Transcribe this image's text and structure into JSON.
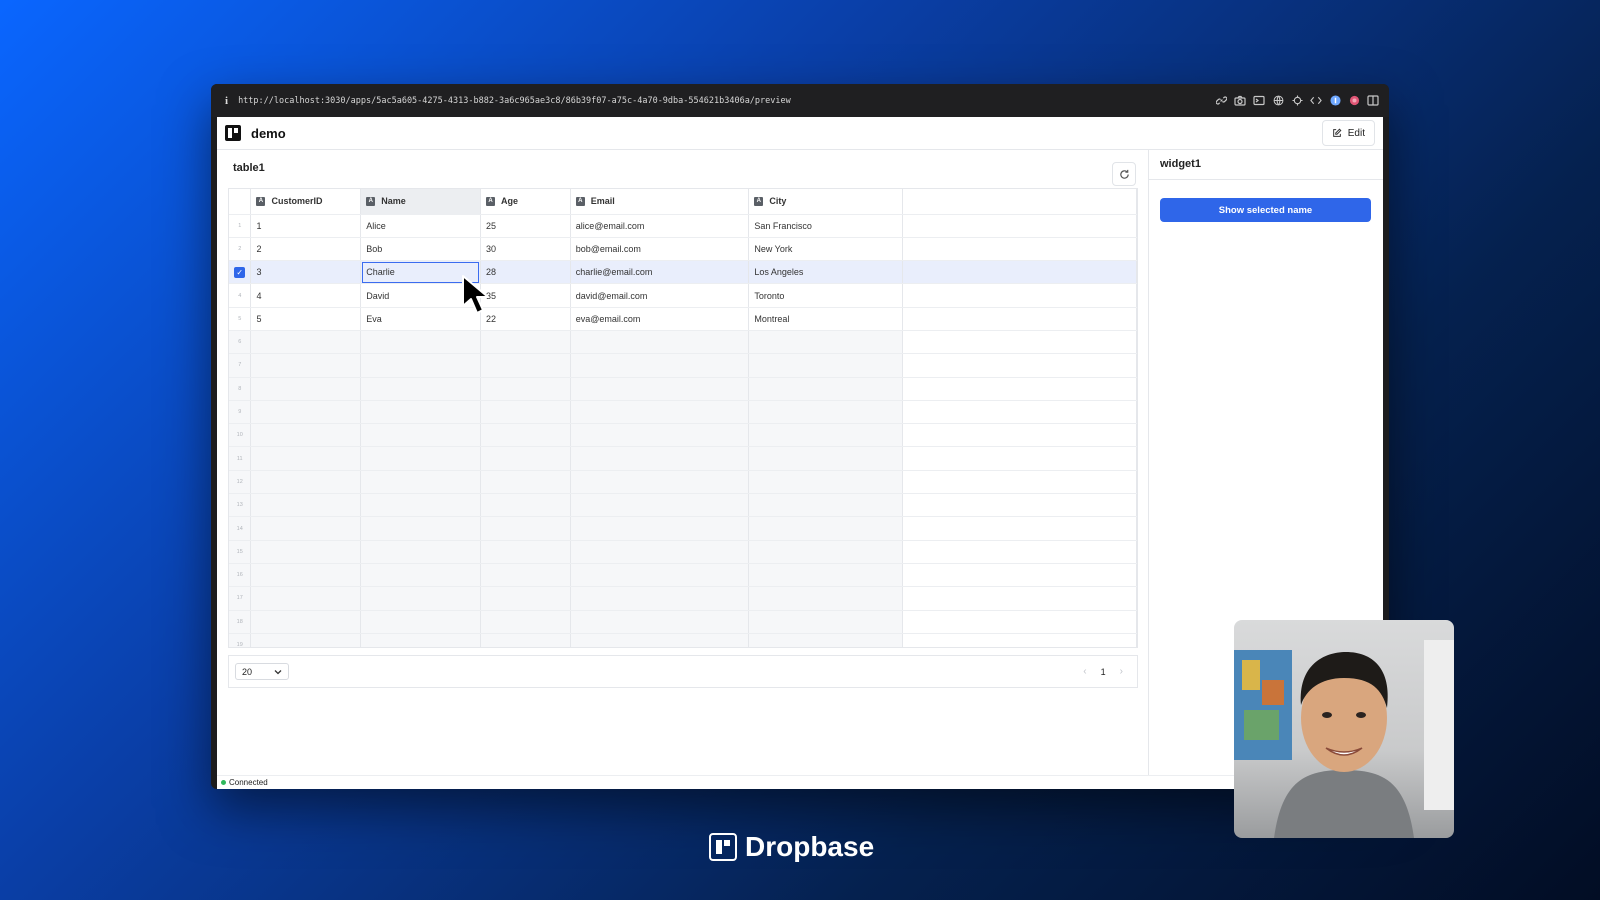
{
  "browser": {
    "url": "http://localhost:3030/apps/5ac5a605-4275-4313-b882-3a6c965ae3c8/86b39f07-a75c-4a70-9dba-554621b3406a/preview",
    "info_icon": "i"
  },
  "app": {
    "title": "demo",
    "edit_label": "Edit"
  },
  "table": {
    "title": "table1",
    "columns": [
      {
        "label": "CustomerID",
        "type": "A"
      },
      {
        "label": "Name",
        "type": "A"
      },
      {
        "label": "Age",
        "type": "A"
      },
      {
        "label": "Email",
        "type": "A"
      },
      {
        "label": "City",
        "type": "A"
      }
    ],
    "rows": [
      {
        "num": "1",
        "CustomerID": "1",
        "Name": "Alice",
        "Age": "25",
        "Email": "alice@email.com",
        "City": "San Francisco"
      },
      {
        "num": "2",
        "CustomerID": "2",
        "Name": "Bob",
        "Age": "30",
        "Email": "bob@email.com",
        "City": "New York"
      },
      {
        "num": "3",
        "CustomerID": "3",
        "Name": "Charlie",
        "Age": "28",
        "Email": "charlie@email.com",
        "City": "Los Angeles"
      },
      {
        "num": "4",
        "CustomerID": "4",
        "Name": "David",
        "Age": "35",
        "Email": "david@email.com",
        "City": "Toronto"
      },
      {
        "num": "5",
        "CustomerID": "5",
        "Name": "Eva",
        "Age": "22",
        "Email": "eva@email.com",
        "City": "Montreal"
      }
    ],
    "empty_row_numbers": [
      "6",
      "7",
      "8",
      "9",
      "10",
      "11",
      "12",
      "13",
      "14",
      "15",
      "16",
      "17",
      "18",
      "19"
    ],
    "selected_row": "3",
    "page_size": "20",
    "current_page": "1"
  },
  "widget": {
    "title": "widget1",
    "button_label": "Show selected name"
  },
  "status": {
    "text": "Connected",
    "color": "#2fb75c"
  },
  "brand": {
    "name": "Dropbase"
  },
  "colors": {
    "accent": "#2f66e9",
    "selected_row_bg": "#e9eefc"
  }
}
